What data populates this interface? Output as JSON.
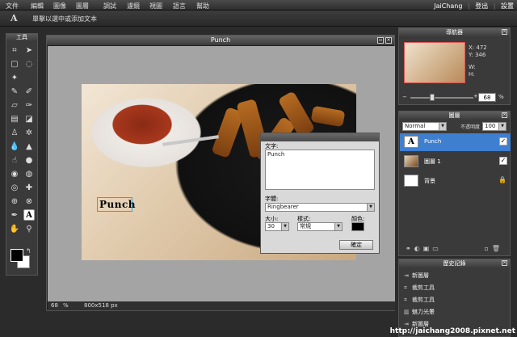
{
  "menu": {
    "items": [
      "文件",
      "編輯",
      "圖像",
      "圖層",
      "調試",
      "濾鏡",
      "視圖",
      "語言",
      "幫助"
    ]
  },
  "user": {
    "name": "JaiChang",
    "logout": "登出",
    "settings": "設置"
  },
  "options": {
    "hint": "單擊以選中或添加文本"
  },
  "toolbox": {
    "title": "工具"
  },
  "document": {
    "title": "Punch",
    "zoom": "68",
    "zoom_unit": "%",
    "size": "800x518 px",
    "text_layer_preview": "Punch"
  },
  "text_dialog": {
    "text_label": "文字:",
    "text_value": "Punch",
    "font_label": "字體:",
    "font_value": "Ringbearer",
    "size_label": "大小:",
    "size_value": "30",
    "style_label": "樣式:",
    "style_value": "常規",
    "color_label": "顏色:",
    "ok_label": "確定"
  },
  "navigator": {
    "title": "導航器",
    "x_label": "X:",
    "x_value": "472",
    "y_label": "Y:",
    "y_value": "346",
    "w_label": "W:",
    "h_label": "H:",
    "zoom": "68",
    "zoom_unit": "%"
  },
  "layers": {
    "title": "圖層",
    "blend_mode": "Normal",
    "opacity_label": "不透明度",
    "opacity_value": "100",
    "items": [
      {
        "name": "Punch",
        "type": "text",
        "visible": true,
        "active": true
      },
      {
        "name": "圖層 1",
        "type": "image",
        "visible": true,
        "active": false
      },
      {
        "name": "背景",
        "type": "background",
        "visible": false,
        "active": false
      }
    ]
  },
  "history": {
    "title": "歷史記錄",
    "items": [
      "新圖層",
      "裁剪工具",
      "裁剪工具",
      "魅力光暈",
      "新圖層"
    ]
  },
  "watermark": "http://jaichang2008.pixnet.net",
  "colors": {
    "accent": "#3f7fcf",
    "panel": "#3a3a3a",
    "canvas_bg": "#a4a4a4"
  }
}
